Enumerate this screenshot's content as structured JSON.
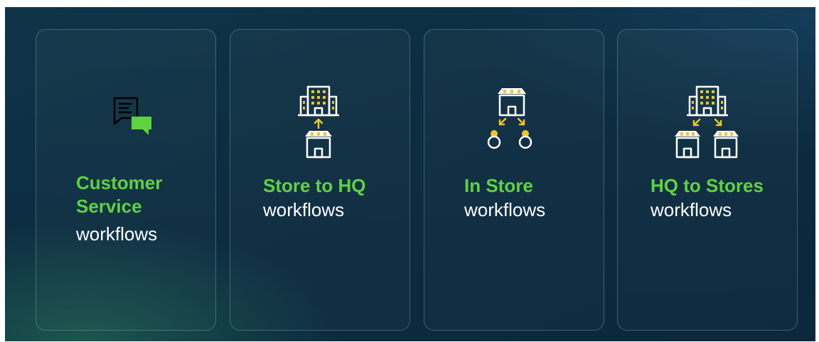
{
  "cards": [
    {
      "title": "Customer Service",
      "subtitle": "workflows",
      "icon": "chat-bubbles-icon"
    },
    {
      "title": "Store to HQ",
      "subtitle": "workflows",
      "icon": "store-to-headquarters-icon"
    },
    {
      "title": "In Store",
      "subtitle": "workflows",
      "icon": "store-with-people-icon"
    },
    {
      "title": "HQ to Stores",
      "subtitle": "workflows",
      "icon": "headquarters-to-stores-icon"
    }
  ],
  "colors": {
    "accent_green": "#5fd241",
    "icon_yellow": "#f2c230",
    "icon_white": "#ffffff",
    "background": "#0c2c40"
  }
}
